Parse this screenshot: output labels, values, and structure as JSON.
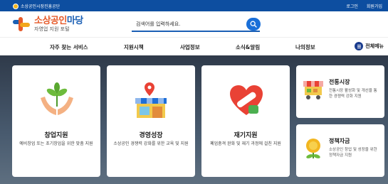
{
  "topbar": {
    "org_name": "소상공인시장진흥공단",
    "login": "로그인",
    "signup": "회원가입"
  },
  "header": {
    "logo_title_a": "소상공인",
    "logo_title_b": "마당",
    "logo_subtitle": "자영업 지원 포털",
    "search_placeholder": "검색어를 입력하세요."
  },
  "nav": {
    "items": [
      "자주 찾는 서비스",
      "지원시책",
      "사업정보",
      "소식&알림",
      "나의정보"
    ],
    "all_menu": "전체메뉴"
  },
  "cards": [
    {
      "title": "창업지원",
      "desc": "예비창업 또는 초기창업을 위한 맞춤 지원",
      "icon": "sprout-hands-icon"
    },
    {
      "title": "경영성장",
      "desc": "소상공인 경쟁력 강화를 위한 교육 및 지원",
      "icon": "store-pin-icon"
    },
    {
      "title": "재기지원",
      "desc": "폐업충격 완화 및 재기 과정에 걸친 지원",
      "icon": "heart-bandage-icon"
    }
  ],
  "side_cards": [
    {
      "title": "전통시장",
      "desc": "전통시장 활성화 및 개선을 통한 경쟁력 강화 지원",
      "icon": "market-cart-icon"
    },
    {
      "title": "정책자금",
      "desc": "소상공인 창업 및 성장을 위한 정책자금 지원",
      "icon": "money-flower-icon"
    }
  ],
  "colors": {
    "primary_blue": "#1a5fb4",
    "topbar": "#0d4ea0",
    "logo_orange": "#e65a2a"
  }
}
